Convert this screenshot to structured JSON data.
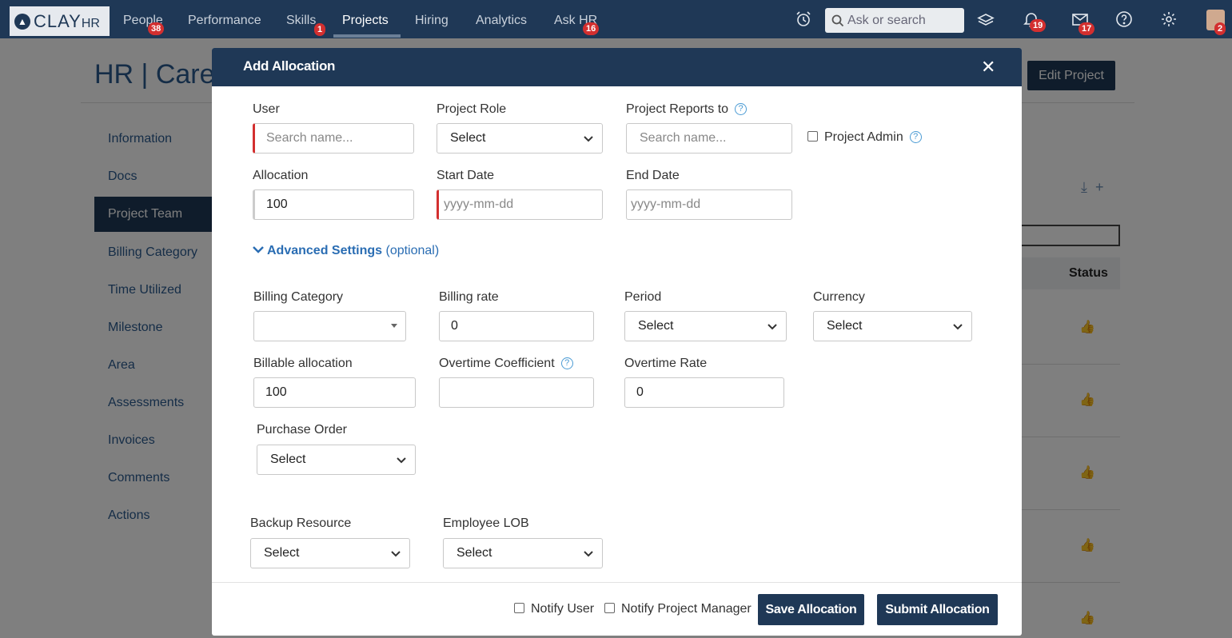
{
  "app": {
    "logo_text": "CLAY",
    "logo_suffix": "HR"
  },
  "nav": {
    "items": [
      {
        "label": "People",
        "badge": "38"
      },
      {
        "label": "Performance",
        "badge": ""
      },
      {
        "label": "Skills",
        "badge": "1"
      },
      {
        "label": "Projects",
        "badge": ""
      },
      {
        "label": "Hiring",
        "badge": ""
      },
      {
        "label": "Analytics",
        "badge": ""
      },
      {
        "label": "Ask HR",
        "badge": "16"
      }
    ],
    "search_placeholder": "Ask or search",
    "notifications_badge": "19",
    "messages_badge": "17",
    "profile_badge": "2"
  },
  "page": {
    "title": "HR | Care",
    "edit_button": "Edit Project",
    "sidebar": [
      "Information",
      "Docs",
      "Project Team",
      "Billing Category",
      "Time Utilized",
      "Milestone",
      "Area",
      "Assessments",
      "Invoices",
      "Comments",
      "Actions"
    ],
    "active_sidebar": "Project Team",
    "status_header": "Status"
  },
  "modal": {
    "title": "Add Allocation",
    "user": {
      "label": "User",
      "placeholder": "Search name..."
    },
    "project_role": {
      "label": "Project Role",
      "value": "Select"
    },
    "project_reports_to": {
      "label": "Project Reports to",
      "placeholder": "Search name..."
    },
    "project_admin": {
      "label": "Project Admin"
    },
    "allocation": {
      "label": "Allocation",
      "value": "100"
    },
    "start_date": {
      "label": "Start Date",
      "placeholder": "yyyy-mm-dd"
    },
    "end_date": {
      "label": "End Date",
      "placeholder": "yyyy-mm-dd"
    },
    "advanced": {
      "label": "Advanced Settings",
      "optional": "(optional)"
    },
    "billing_category": {
      "label": "Billing Category",
      "value": ""
    },
    "billing_rate": {
      "label": "Billing rate",
      "value": "0"
    },
    "period": {
      "label": "Period",
      "value": "Select"
    },
    "currency": {
      "label": "Currency",
      "value": "Select"
    },
    "billable_allocation": {
      "label": "Billable allocation",
      "value": "100"
    },
    "overtime_coefficient": {
      "label": "Overtime Coefficient",
      "value": ""
    },
    "overtime_rate": {
      "label": "Overtime Rate",
      "value": "0"
    },
    "purchase_order": {
      "label": "Purchase Order",
      "value": "Select"
    },
    "backup_resource": {
      "label": "Backup Resource",
      "value": "Select"
    },
    "employee_lob": {
      "label": "Employee LOB",
      "value": "Select"
    },
    "notify_user": "Notify User",
    "notify_pm": "Notify Project Manager",
    "save_button": "Save Allocation",
    "submit_button": "Submit Allocation"
  }
}
